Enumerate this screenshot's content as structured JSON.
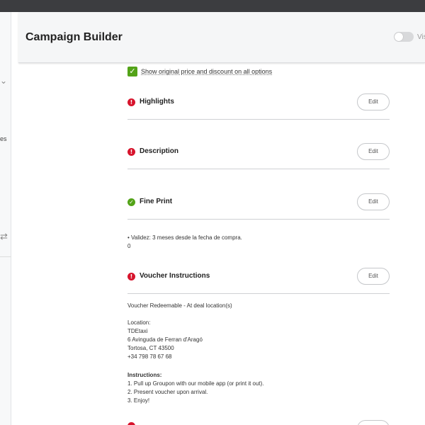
{
  "header": {
    "title": "Campaign Builder",
    "toggle_label": "Vis"
  },
  "sidebar": {
    "partial_text": "es",
    "chevron_icon": "chevron-down-icon",
    "swap_icon": "swap-arrows-icon"
  },
  "options": {
    "show_original_price_label": "Show original price and discount on all options",
    "show_original_price_checked": true
  },
  "sections": [
    {
      "title": "Highlights",
      "status": "error",
      "edit_label": "Edit"
    },
    {
      "title": "Description",
      "status": "error",
      "edit_label": "Edit"
    },
    {
      "title": "Fine Print",
      "status": "complete",
      "edit_label": "Edit"
    },
    {
      "title": "Voucher Instructions",
      "status": "error",
      "edit_label": "Edit"
    }
  ],
  "fine_print": {
    "bullet": "Validez: 3 meses desde la fecha de compra.",
    "extra": "0"
  },
  "voucher": {
    "redeemable": "Voucher Redeemable - At deal location(s)",
    "location_label": "Location:",
    "location_lines": [
      "TDEtaxi",
      "6 Avinguda de Ferran d'Aragó",
      "Tortosa, CT 43500",
      "+34 798 78 67 68"
    ],
    "instructions_label": "Instructions:",
    "instructions_lines": [
      "1. Pull up Groupon with our mobile app (or print it out).",
      "2. Present voucher upon arrival.",
      "3. Enjoy!"
    ]
  },
  "colors": {
    "error": "#d7142c",
    "success": "#53a318",
    "topbar": "#3c3d40"
  }
}
